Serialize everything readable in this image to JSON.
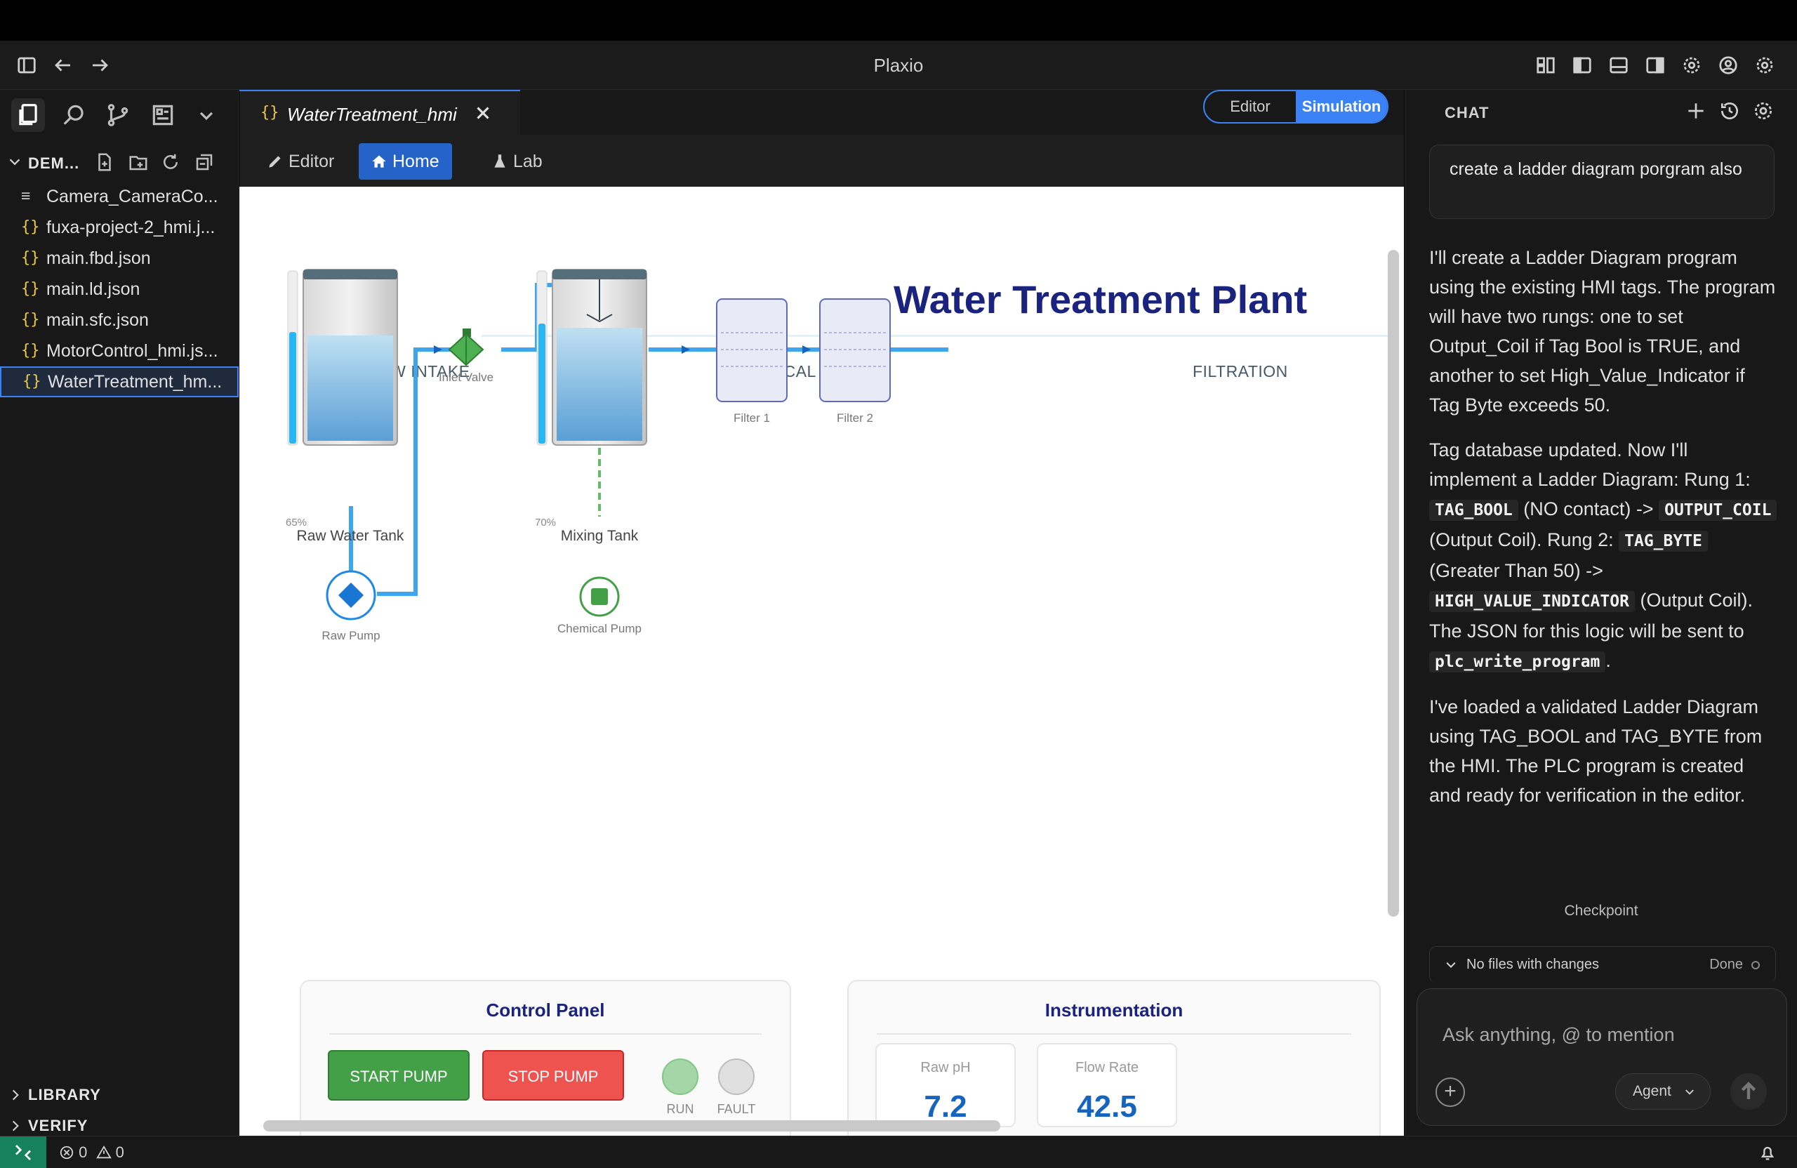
{
  "app": {
    "title": "Plaxio"
  },
  "explorer": {
    "root_label": "DEM...",
    "files": [
      {
        "icon": "lines",
        "name": "Camera_CameraCo..."
      },
      {
        "icon": "braces",
        "name": "fuxa-project-2_hmi.j..."
      },
      {
        "icon": "braces",
        "name": "main.fbd.json"
      },
      {
        "icon": "braces",
        "name": "main.ld.json"
      },
      {
        "icon": "braces",
        "name": "main.sfc.json"
      },
      {
        "icon": "braces",
        "name": "MotorControl_hmi.js..."
      },
      {
        "icon": "braces",
        "name": "WaterTreatment_hm..."
      }
    ],
    "library_label": "LIBRARY",
    "verify_label": "VERIFY"
  },
  "editor": {
    "tab_label": "WaterTreatment_hmi",
    "tab_icon": "{}",
    "mode_editor": "Editor",
    "mode_simulation": "Simulation",
    "nav_editor": "Editor",
    "nav_home": "Home",
    "nav_lab": "Lab"
  },
  "hmi": {
    "title": "Water Treatment Plant",
    "sections": {
      "raw_intake": "RAW INTAKE",
      "chemical_mixing": "CHEMICAL MIXING",
      "filtration": "FILTRATION"
    },
    "raw_tank": {
      "label": "Raw Water Tank",
      "level_label": "65%",
      "level": 0.65
    },
    "mixing_tank": {
      "label": "Mixing Tank",
      "level_label": "70%",
      "level": 0.7
    },
    "inlet_valve": "Inlet Valve",
    "filter1": "Filter 1",
    "filter2": "Filter 2",
    "raw_pump": "Raw Pump",
    "chemical_pump": "Chemical Pump",
    "control_panel": {
      "title": "Control Panel",
      "start": "START PUMP",
      "stop": "STOP PUMP",
      "run": "RUN",
      "fault": "FAULT"
    },
    "instrumentation": {
      "title": "Instrumentation",
      "raw_ph_label": "Raw pH",
      "raw_ph_value": "7.2",
      "flow_label": "Flow Rate",
      "flow_value": "42.5"
    },
    "colors": {
      "title": "#1a237e",
      "pipe": "#3ea6ee",
      "chem_line": "#66bb6a",
      "water": "#7fb8e0"
    }
  },
  "chat": {
    "header": "CHAT",
    "user_message": "create a ladder diagram porgram also",
    "p1": "I'll create a Ladder Diagram program using the existing HMI tags. The program will have two rungs: one to set Output_Coil if Tag Bool is TRUE, and another to set High_Value_Indicator if Tag Byte exceeds 50.",
    "p2a": "Tag database updated. Now I'll implement a Ladder Diagram: Rung 1: ",
    "code_tag_bool": "TAG_BOOL",
    "p2b": " (NO contact) -> ",
    "code_output_coil": "OUTPUT_COIL",
    "p2c": " (Output Coil). Rung 2: ",
    "code_tag_byte": "TAG_BYTE",
    "p2d": " (Greater Than 50) -> ",
    "code_high_value": "HIGH_VALUE_INDICATOR",
    "p2e": " (Output Coil). The JSON for this logic will be sent to ",
    "code_plc_write": "plc_write_program",
    "p2f": ".",
    "p3": "I've loaded a validated Ladder Diagram using TAG_BOOL and TAG_BYTE from the HMI. The PLC program is created and ready for verification in the editor.",
    "checkpoint": "Checkpoint",
    "files_label": "No files with changes",
    "files_done": "Done",
    "input_placeholder": "Ask anything, @ to mention",
    "agent_label": "Agent"
  },
  "status": {
    "errors": "0",
    "warnings": "0"
  }
}
